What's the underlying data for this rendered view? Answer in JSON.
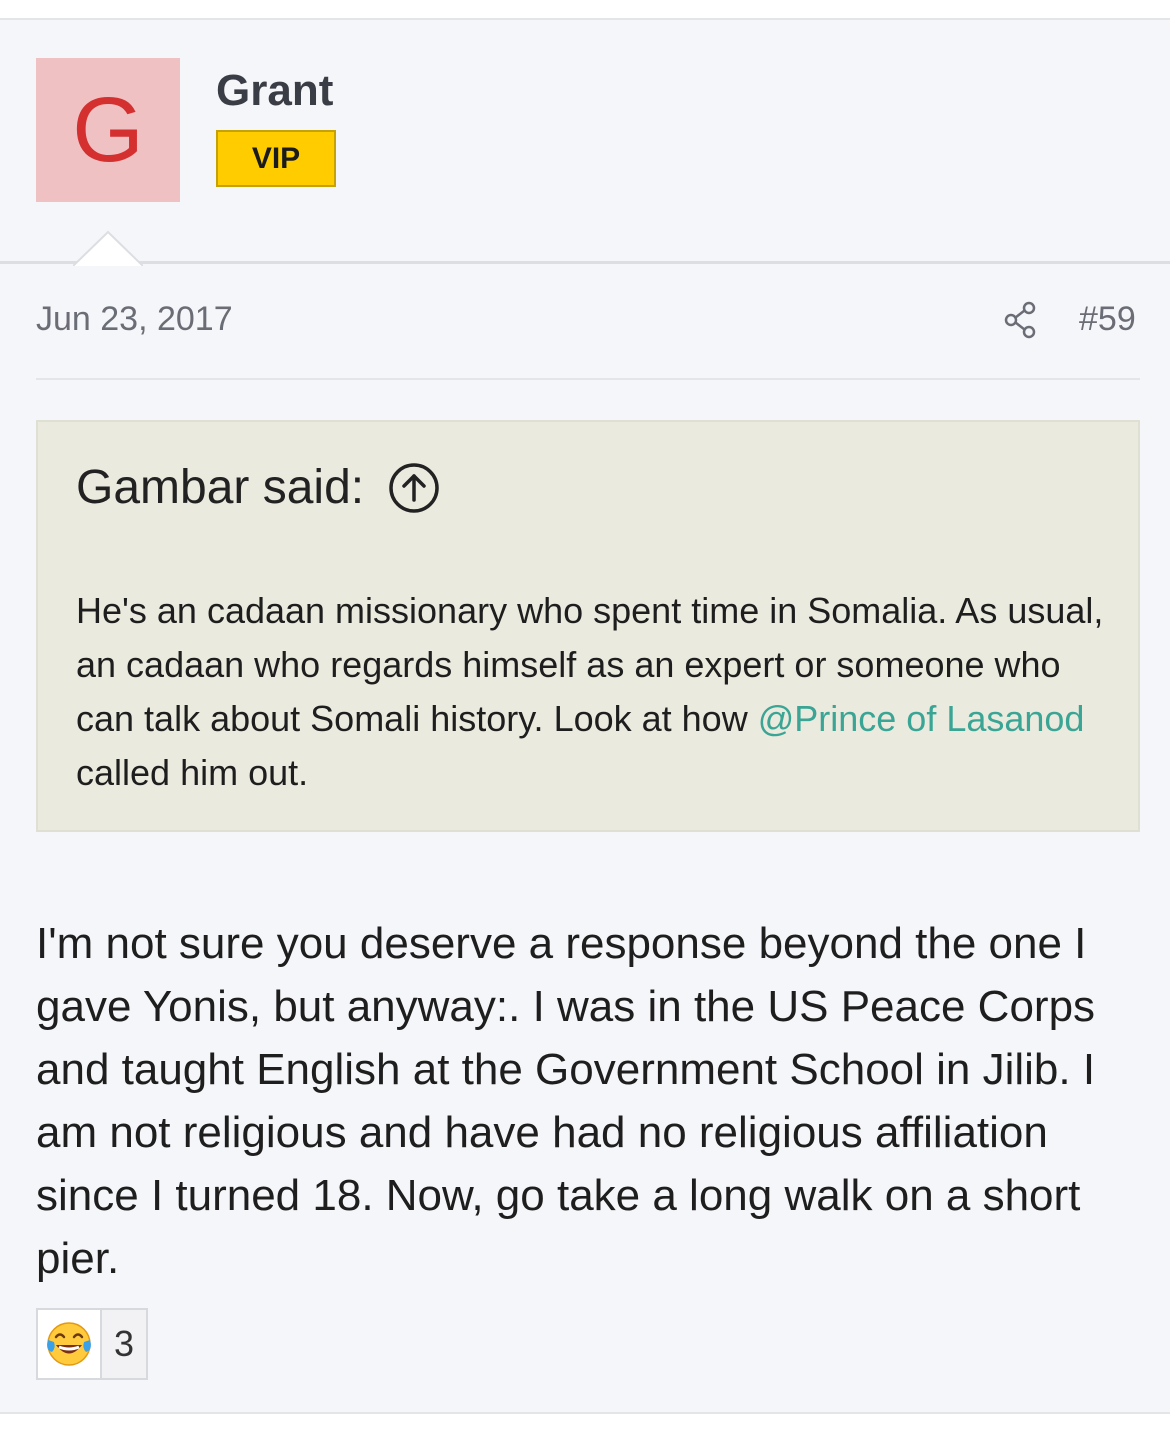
{
  "post": {
    "author": {
      "avatar_letter": "G",
      "avatar_bg": "#f0c1c3",
      "avatar_fg": "#d3302f",
      "name": "Grant",
      "badge": "VIP",
      "badge_color": "#ffcc00"
    },
    "date": "Jun 23, 2017",
    "share_icon": "share-icon",
    "number": "#59",
    "quote": {
      "header": "Gambar said:",
      "jump_icon": "arrow-up-circle-icon",
      "text_part1": "He's an cadaan missionary who spent time in Somalia. As usual, an cadaan who regards himself as an expert or someone who can talk about Somali history. Look at how ",
      "mention": "@Prince of Lasanod",
      "text_part2": " called him out."
    },
    "message": "I'm not sure you deserve a response beyond the one I gave Yonis, but anyway:. I was in the US Peace Corps and taught English at the Government School in Jilib. I am not religious and have had no religious affiliation since I turned 18. Now, go take a long walk on a short pier.",
    "reactions": {
      "emoji": "tears-of-joy-emoji",
      "count": "3"
    }
  }
}
